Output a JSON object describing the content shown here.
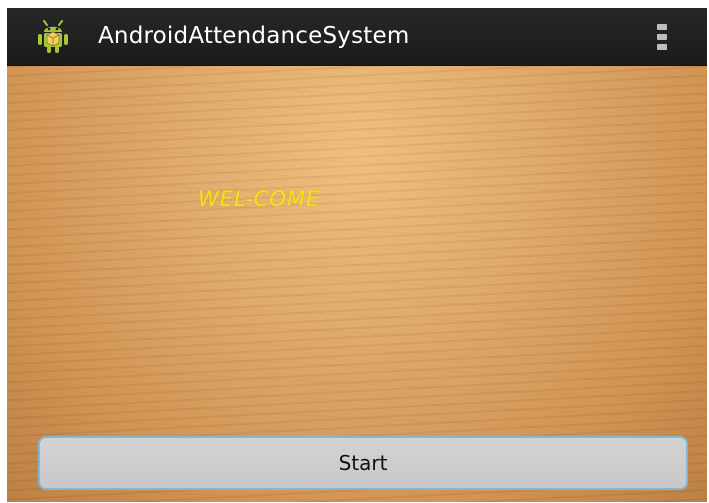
{
  "app_bar": {
    "title": "AndroidAttendanceSystem",
    "app_icon": "android-robot-icon",
    "overflow_icon": "overflow-menu-icon",
    "background_color": "#1f1f1f",
    "title_color": "#ffffff"
  },
  "content": {
    "welcome_text": "WEL-COME",
    "welcome_color": "#f5e414",
    "background": "wood-texture"
  },
  "actions": {
    "start_label": "Start",
    "button_border_color": "#84b7d4"
  }
}
